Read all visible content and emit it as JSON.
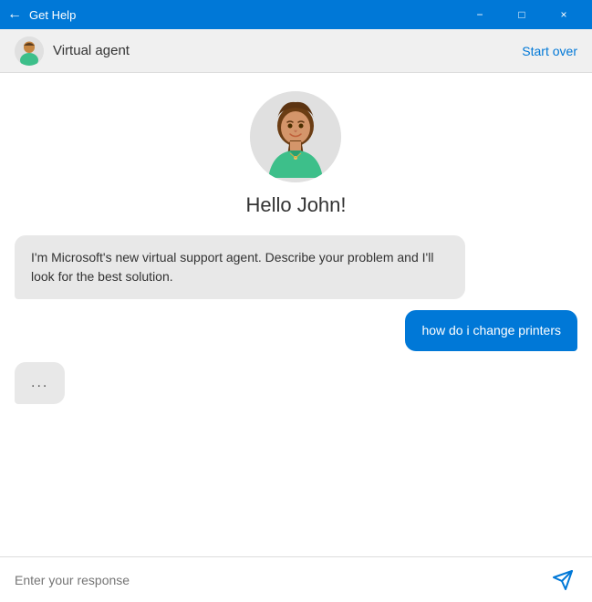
{
  "titlebar": {
    "title": "Get Help",
    "min_label": "−",
    "max_label": "□",
    "close_label": "×",
    "back_icon": "←"
  },
  "header": {
    "agent_name": "Virtual agent",
    "start_over_label": "Start over"
  },
  "chat": {
    "greeting": "Hello John!",
    "agent_message": "I'm Microsoft's new virtual support agent. Describe your problem and I'll look for the best solution.",
    "user_message": "how do i change printers",
    "typing_indicator": "..."
  },
  "input": {
    "placeholder": "Enter your response"
  }
}
